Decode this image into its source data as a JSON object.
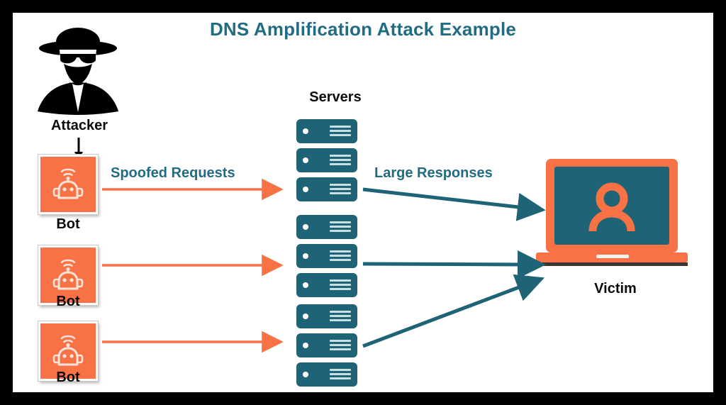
{
  "diagram": {
    "title": "DNS Amplification Attack Example",
    "colors": {
      "teal": "#1f6476",
      "title_teal": "#216c82",
      "orange": "#f97245",
      "black": "#000000",
      "white": "#ffffff",
      "border": "#000000"
    },
    "attacker": {
      "label": "Attacker",
      "icon": "attacker-silhouette-icon",
      "arrow_icon": "down-arrow-icon"
    },
    "bots": [
      {
        "label": "Bot",
        "icon": "robot-icon"
      },
      {
        "label": "Bot",
        "icon": "robot-icon"
      },
      {
        "label": "Bot",
        "icon": "robot-icon"
      }
    ],
    "servers": {
      "title": "Servers",
      "groups": [
        {
          "count": 3,
          "icon": "server-icon"
        },
        {
          "count": 3,
          "icon": "server-icon"
        },
        {
          "count": 3,
          "icon": "server-icon"
        }
      ]
    },
    "flows": [
      {
        "label": "Spoofed Requests",
        "color": "#f97245",
        "direction": "bot-to-server",
        "arrow_icon": "right-arrow-icon"
      },
      {
        "label": "Large Responses",
        "color": "#1f6476",
        "direction": "server-to-victim",
        "arrow_icon": "right-arrow-icon"
      }
    ],
    "victim": {
      "label": "Victim",
      "icon": "laptop-with-user-icon",
      "screen_icon": "person-icon"
    }
  }
}
